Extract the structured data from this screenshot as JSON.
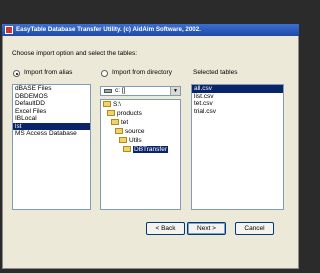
{
  "window": {
    "title": "EasyTable Database Transfer Utility. (c) AidAim Software, 2002."
  },
  "instruction": "Choose import option and select the tables:",
  "options": {
    "alias_label": "Import from alias",
    "directory_label": "Import from directory",
    "selected": "alias"
  },
  "alias_list": {
    "items": [
      "dBASE Files",
      "DBDEMOS",
      "DefaultDD",
      "Excel Files",
      "IBLocal",
      "lst",
      "MS Access Database"
    ],
    "selected_index": 5
  },
  "drive": {
    "value": "c: []"
  },
  "folder_tree": {
    "items": [
      "S:\\",
      "products",
      "tet",
      "source",
      "Utils",
      "DBTransfer"
    ],
    "selected_index": 5
  },
  "selected_tables": {
    "header": "Selected tables",
    "items": [
      "all.csv",
      "list.csv",
      "tet.csv",
      "trial.csv"
    ],
    "selected_index": 0
  },
  "buttons": {
    "back": "< Back",
    "next": "Next >",
    "cancel": "Cancel"
  }
}
